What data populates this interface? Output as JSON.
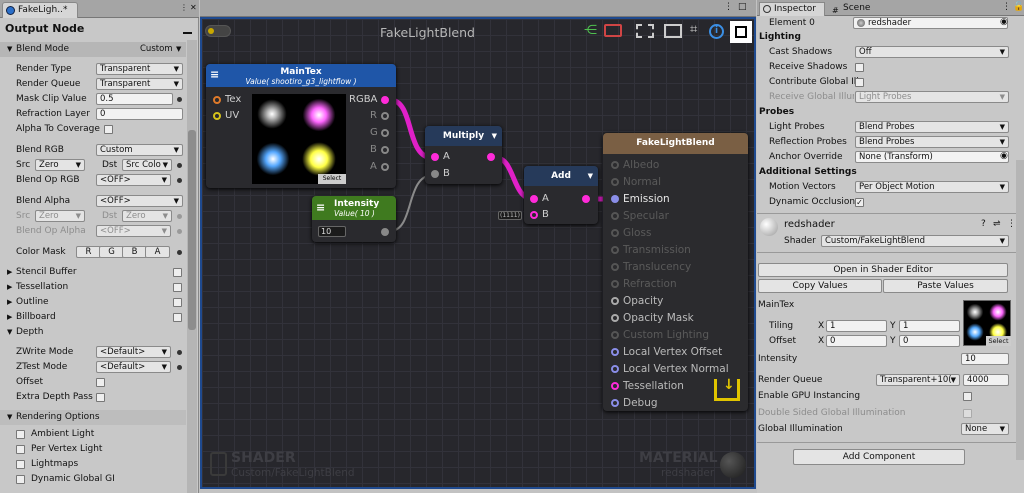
{
  "left_tab": {
    "title": "FakeLigh..*"
  },
  "output_node": {
    "title": "Output Node"
  },
  "blend_mode": {
    "label": "Blend Mode",
    "value": "Custom"
  },
  "props": [
    {
      "label": "Render Type",
      "value": "Transparent"
    },
    {
      "label": "Render Queue",
      "value": "Transparent"
    },
    {
      "label": "Mask Clip Value",
      "value": "0.5"
    },
    {
      "label": "Refraction Layer",
      "value": "0"
    },
    {
      "label": "Alpha To Coverage"
    }
  ],
  "blend_rgb": {
    "label": "Blend RGB",
    "value": "Custom",
    "src_label": "Src",
    "src": "Zero",
    "dst_label": "Dst",
    "dst": "Src Colo",
    "op_label": "Blend Op RGB",
    "op": "<OFF>"
  },
  "blend_alpha": {
    "label": "Blend Alpha",
    "value": "<OFF>",
    "src_label": "Src",
    "src": "Zero",
    "dst_label": "Dst",
    "dst": "Zero",
    "op_label": "Blend Op Alpha",
    "op": "<OFF>"
  },
  "color_mask": {
    "label": "Color Mask",
    "r": "R",
    "g": "G",
    "b": "B",
    "a": "A"
  },
  "foldouts": [
    "Stencil Buffer",
    "Tessellation",
    "Outline",
    "Billboard"
  ],
  "depth": {
    "label": "Depth",
    "zwrite_label": "ZWrite Mode",
    "zwrite": "<Default>",
    "ztest_label": "ZTest Mode",
    "ztest": "<Default>",
    "offset": "Offset",
    "extra": "Extra Depth Pass"
  },
  "rendering_options": {
    "label": "Rendering Options",
    "items": [
      "Ambient Light",
      "Per Vertex Light",
      "Lightmaps",
      "Dynamic Global GI"
    ]
  },
  "graph": {
    "title": "FakeLightBlend",
    "maintex": {
      "title": "MainTex",
      "subtitle": "Value( shootiro_g3_lightflow )",
      "in1": "Tex",
      "in2": "UV",
      "out": "RGBA",
      "r": "R",
      "g": "G",
      "b": "B",
      "a": "A",
      "select": "Select"
    },
    "intensity": {
      "title": "Intensity",
      "subtitle": "Value( 10 )",
      "value": "10"
    },
    "multiply": {
      "title": "Multiply",
      "a": "A",
      "b": "B"
    },
    "add": {
      "title": "Add",
      "a": "A",
      "b": "B",
      "badge": "(1111)"
    },
    "output": {
      "title": "FakeLightBlend",
      "ports": [
        "Albedo",
        "Normal",
        "Emission",
        "Specular",
        "Gloss",
        "Transmission",
        "Translucency",
        "Refraction",
        "Opacity",
        "Opacity Mask",
        "Custom Lighting",
        "Local Vertex Offset",
        "Local Vertex Normal",
        "Tessellation",
        "Debug"
      ]
    },
    "shader_label": "SHADER",
    "shader_name": "Custom/FakeLightBlend",
    "material_label": "MATERIAL",
    "material_name": "redshader"
  },
  "inspector": {
    "tabs": [
      "Inspector",
      "Scene"
    ],
    "element0_label": "Element 0",
    "element0_value": "redshader",
    "lighting": "Lighting",
    "cast_shadows_label": "Cast Shadows",
    "cast_shadows": "Off",
    "receive_shadows": "Receive Shadows",
    "contribute_gi": "Contribute Global Illu",
    "receive_gi_label": "Receive Global Illum",
    "receive_gi": "Light Probes",
    "probes": "Probes",
    "light_probes_label": "Light Probes",
    "light_probes": "Blend Probes",
    "reflection_probes_label": "Reflection Probes",
    "reflection_probes": "Blend Probes",
    "anchor_label": "Anchor Override",
    "anchor": "None (Transform)",
    "additional": "Additional Settings",
    "motion_label": "Motion Vectors",
    "motion": "Per Object Motion",
    "dyn_occ": "Dynamic Occlusion",
    "material_name": "redshader",
    "shader_label": "Shader",
    "shader": "Custom/FakeLightBlend",
    "open_editor": "Open in Shader Editor",
    "copy_values": "Copy Values",
    "paste_values": "Paste Values",
    "maintex": "MainTex",
    "tiling": "Tiling",
    "offset": "Offset",
    "tiling_x": "1",
    "tiling_y": "1",
    "offset_x": "0",
    "offset_y": "0",
    "x": "X",
    "y": "Y",
    "select": "Select",
    "intensity_label": "Intensity",
    "intensity": "10",
    "render_queue_label": "Render Queue",
    "render_queue": "Transparent+10(",
    "render_queue_value": "4000",
    "gpu": "Enable GPU Instancing",
    "double_sided": "Double Sided Global Illumination",
    "gi_label": "Global Illumination",
    "gi": "None",
    "add_component": "Add Component"
  }
}
